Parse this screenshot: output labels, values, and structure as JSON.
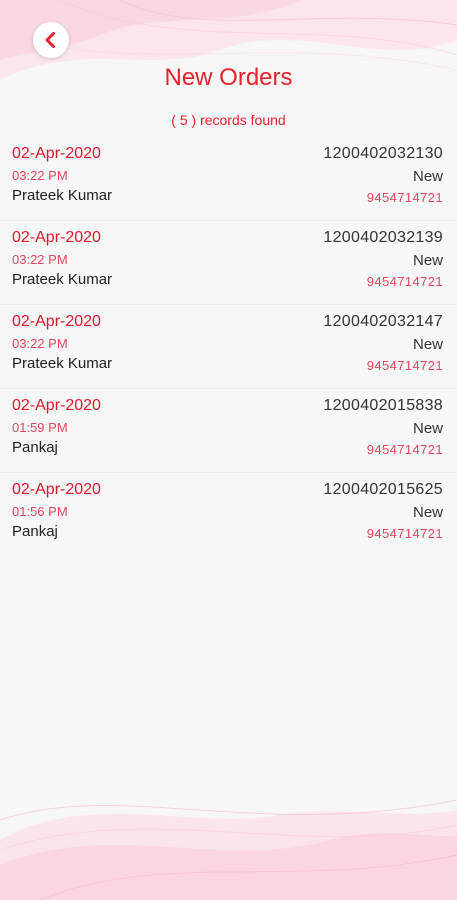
{
  "header": {
    "title": "New Orders",
    "records_found": "( 5 ) records found"
  },
  "icons": {
    "back": "chevron-left-icon"
  },
  "colors": {
    "accent": "#e8202c",
    "accent_light": "#e8435a",
    "text_dark": "#222222",
    "background": "#f7f7f7"
  },
  "orders": [
    {
      "date": "02-Apr-2020",
      "time": "03:22 PM",
      "customer": "Prateek Kumar",
      "order_id": "1200402032130",
      "status": "New",
      "phone": "9454714721"
    },
    {
      "date": "02-Apr-2020",
      "time": "03:22 PM",
      "customer": "Prateek Kumar",
      "order_id": "1200402032139",
      "status": "New",
      "phone": "9454714721"
    },
    {
      "date": "02-Apr-2020",
      "time": "03:22 PM",
      "customer": "Prateek Kumar",
      "order_id": "1200402032147",
      "status": "New",
      "phone": "9454714721"
    },
    {
      "date": "02-Apr-2020",
      "time": "01:59 PM",
      "customer": "Pankaj",
      "order_id": "1200402015838",
      "status": "New",
      "phone": "9454714721"
    },
    {
      "date": "02-Apr-2020",
      "time": "01:56 PM",
      "customer": "Pankaj",
      "order_id": "1200402015625",
      "status": "New",
      "phone": "9454714721"
    }
  ]
}
